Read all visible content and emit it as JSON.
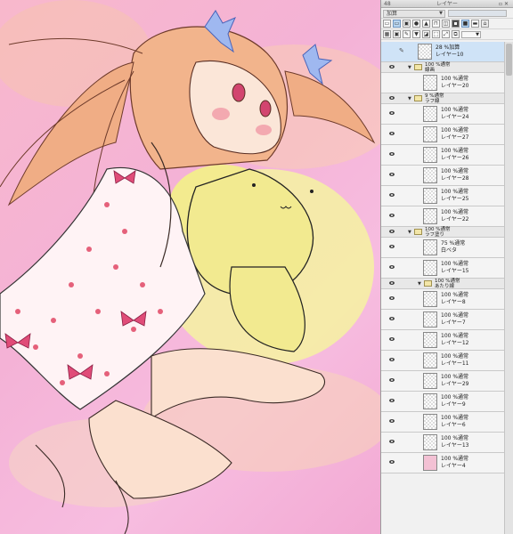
{
  "panel": {
    "title": "レイヤー",
    "number": "48",
    "blend_mode": "加算",
    "opacity_percent": 100,
    "toolbar_icons": [
      "new-raster-layer-icon",
      "new-vector-layer-icon",
      "new-folder-icon",
      "mask-icon",
      "lock-icon",
      "clip-icon",
      "reference-icon",
      "draft-icon",
      "color-icon",
      "layer-color-icon",
      "trash-icon"
    ],
    "layers": [
      {
        "name": "レイヤー10",
        "blend": "28 %加算",
        "type": "layer",
        "selected": true,
        "visible": false,
        "pen": true
      },
      {
        "name": "線画",
        "blend": "100 %通常",
        "type": "folder",
        "visible": true
      },
      {
        "name": "レイヤー20",
        "blend": "100 %通常",
        "type": "layer",
        "visible": false,
        "indent": 2
      },
      {
        "name": "ラフ線",
        "blend": "9 %通常",
        "type": "folder",
        "visible": true
      },
      {
        "name": "レイヤー24",
        "blend": "100 %通常",
        "type": "layer",
        "visible": true,
        "indent": 2
      },
      {
        "name": "レイヤー27",
        "blend": "100 %通常",
        "type": "layer",
        "visible": true,
        "indent": 2
      },
      {
        "name": "レイヤー26",
        "blend": "100 %通常",
        "type": "layer",
        "visible": true,
        "indent": 2
      },
      {
        "name": "レイヤー28",
        "blend": "100 %通常",
        "type": "layer",
        "visible": true,
        "indent": 2
      },
      {
        "name": "レイヤー25",
        "blend": "100 %通常",
        "type": "layer",
        "visible": true,
        "indent": 2
      },
      {
        "name": "レイヤー22",
        "blend": "100 %通常",
        "type": "layer",
        "visible": true,
        "indent": 2
      },
      {
        "name": "ラフ塗り",
        "blend": "100 %通常",
        "type": "folder",
        "visible": true
      },
      {
        "name": "白ベタ",
        "blend": "75 %通常",
        "type": "layer",
        "visible": true,
        "indent": 2
      },
      {
        "name": "レイヤー15",
        "blend": "100 %通常",
        "type": "layer",
        "visible": true,
        "indent": 2
      },
      {
        "name": "あたり線",
        "blend": "100 %通常",
        "type": "folder",
        "visible": true,
        "sub": true
      },
      {
        "name": "レイヤー8",
        "blend": "100 %通常",
        "type": "layer",
        "visible": true,
        "indent": 2
      },
      {
        "name": "レイヤー7",
        "blend": "100 %通常",
        "type": "layer",
        "visible": true,
        "indent": 2
      },
      {
        "name": "レイヤー12",
        "blend": "100 %通常",
        "type": "layer",
        "visible": true,
        "indent": 2
      },
      {
        "name": "レイヤー11",
        "blend": "100 %通常",
        "type": "layer",
        "visible": true,
        "indent": 2
      },
      {
        "name": "レイヤー29",
        "blend": "100 %通常",
        "type": "layer",
        "visible": true,
        "indent": 2
      },
      {
        "name": "レイヤー9",
        "blend": "100 %通常",
        "type": "layer",
        "visible": true,
        "indent": 2
      },
      {
        "name": "レイヤー6",
        "blend": "100 %通常",
        "type": "layer",
        "visible": true,
        "indent": 2
      },
      {
        "name": "レイヤー13",
        "blend": "100 %通常",
        "type": "layer",
        "visible": true,
        "indent": 2
      },
      {
        "name": "レイヤー4",
        "blend": "100 %通常",
        "type": "layer",
        "visible": true,
        "indent": 2,
        "thumb": "pink"
      }
    ]
  }
}
